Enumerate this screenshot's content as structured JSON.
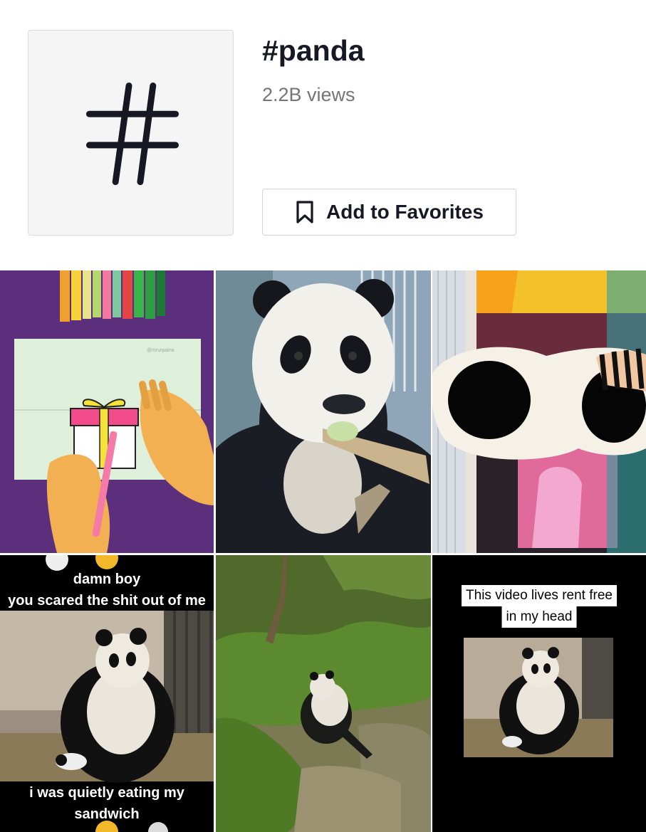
{
  "tag": {
    "title": "#panda",
    "views": "2.2B views",
    "icon": "hashtag-icon"
  },
  "favorites": {
    "label": "Add to Favorites",
    "icon": "bookmark-icon"
  },
  "videos": [
    {
      "id": "drawing",
      "watermark": "@mrurpaina"
    },
    {
      "id": "panda-eating"
    },
    {
      "id": "sunglasses"
    },
    {
      "id": "scared-panda",
      "caption_top_1": "damn boy",
      "caption_top_2": "you scared the shit out of me",
      "caption_bottom_1": "i was quietly eating my",
      "caption_bottom_2": "sandwich"
    },
    {
      "id": "panda-bushes"
    },
    {
      "id": "rent-free",
      "caption_1": "This video lives rent free",
      "caption_2": "in my head"
    }
  ],
  "colors": {
    "text": "#161823",
    "muted": "#757575",
    "purple": "#5b2f7c"
  }
}
